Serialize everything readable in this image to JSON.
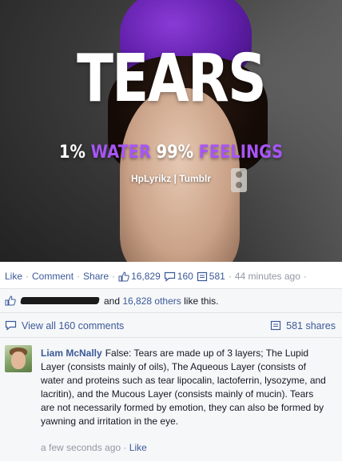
{
  "image": {
    "title": "TEARS",
    "subtitle_prefix": "1%",
    "subtitle_water": "WATER",
    "subtitle_middle": "99%",
    "subtitle_feelings": "FEELINGS",
    "credit": "HpLyrikz | Tumblr"
  },
  "actions": {
    "like": "Like",
    "comment": "Comment",
    "share": "Share",
    "separator": "·",
    "likes_count": "16,829",
    "comments_count": "160",
    "shares_count": "581",
    "time": "44 minutes ago",
    "icons": {
      "likes": "thumbs-up-icon",
      "comments": "comment-bubble-icon",
      "shares": "share-icon"
    }
  },
  "likes_summary": {
    "and_text": "and",
    "others_link": "16,828 others",
    "suffix": "like this."
  },
  "comments_bar": {
    "view_all": "View all 160 comments",
    "shares": "581 shares"
  },
  "comment": {
    "author": "Liam McNally",
    "text": "False: Tears are made up of 3 layers; The Lupid Layer (consists mainly of oils), The Aqueous Layer (consists of water and proteins such as tear lipocalin, lactoferrin, lysozyme, and lacritin), and the Mucous Layer (consists mainly of mucin). Tears are not necessarily formed by emotion, they can also be formed by yawning and irritation in the eye.",
    "time": "a few seconds ago",
    "separator": "·",
    "like": "Like"
  },
  "colors": {
    "link": "#3b5998",
    "meta": "#9197a3",
    "accent_purple": "#a855f7",
    "ufi_background": "#f6f7f9"
  }
}
